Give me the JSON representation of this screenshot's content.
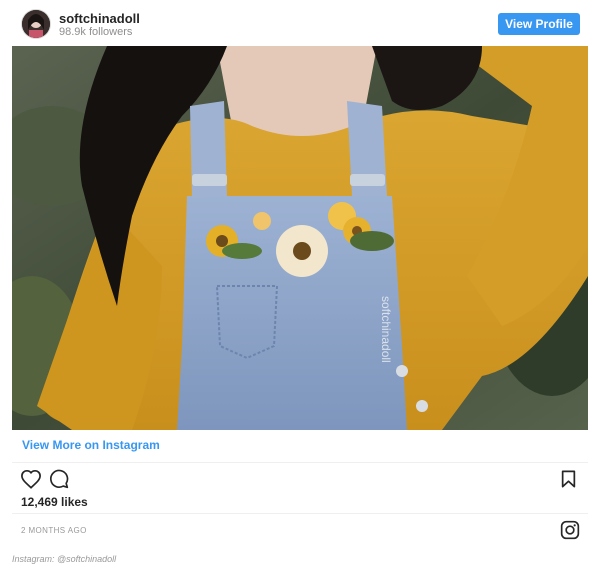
{
  "header": {
    "username": "softchinadoll",
    "followers": "98.9k followers",
    "view_profile_label": "View Profile"
  },
  "photo": {
    "watermark": "softchinadoll",
    "colors": {
      "sweater": "#d8a22a",
      "denim": "#8da4c8",
      "hair": "#15110f",
      "foliage": "#3f4a3a",
      "skin": "#e4c9b8"
    }
  },
  "links": {
    "view_more": "View More on Instagram"
  },
  "actions": {
    "like_icon": "heart-icon",
    "comment_icon": "comment-icon",
    "save_icon": "bookmark-icon"
  },
  "likes": "12,469 likes",
  "timestamp": "2 MONTHS AGO",
  "caption": "Instagram: @softchinadoll",
  "colors": {
    "accent": "#3897f0",
    "muted": "#8e8e8e",
    "text": "#262626"
  }
}
